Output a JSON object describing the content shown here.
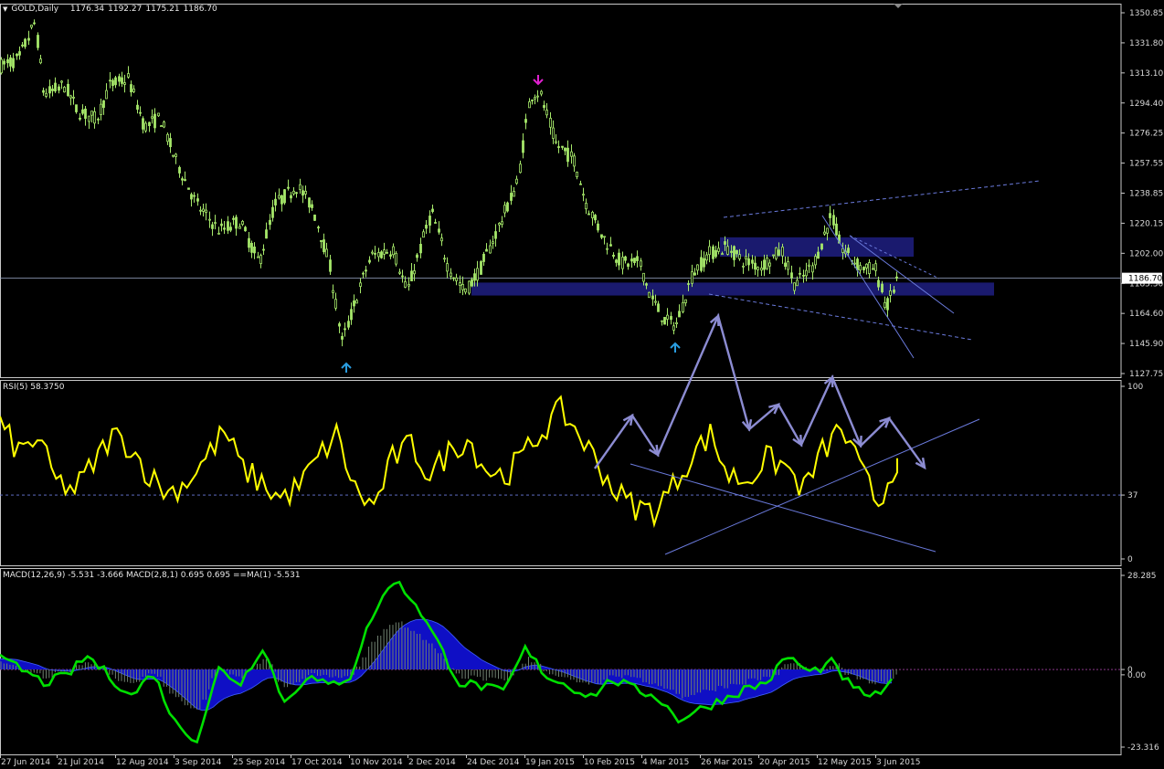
{
  "panels": {
    "price": {
      "symbol_label": "GOLD,Daily",
      "ohlc": [
        "1176.34",
        "1192.27",
        "1175.21",
        "1186.70"
      ],
      "current_price_tag": "1186.70",
      "y_ticks": [
        "1350.85",
        "1331.80",
        "1313.10",
        "1294.40",
        "1276.25",
        "1257.55",
        "1238.85",
        "1220.15",
        "1202.00",
        "1185.30",
        "1164.60",
        "1145.90",
        "1127.75"
      ]
    },
    "rsi": {
      "label": "RSI(5) 58.3750",
      "y_ticks": [
        "100",
        "37",
        "0"
      ]
    },
    "macd": {
      "label": "MACD(12,26,9) -5.531 -3.666  MACD(2,8,1) 0.695 0.695  ==MA(1) -5.531",
      "y_ticks": [
        "28.285",
        "0",
        "0.00",
        "-23.316"
      ]
    }
  },
  "x_axis_labels": [
    "27 Jun 2014",
    "21 Jul 2014",
    "12 Aug 2014",
    "3 Sep 2014",
    "25 Sep 2014",
    "17 Oct 2014",
    "10 Nov 2014",
    "2 Dec 2014",
    "24 Dec 2014",
    "19 Jan 2015",
    "10 Feb 2015",
    "4 Mar 2015",
    "26 Mar 2015",
    "20 Apr 2015",
    "12 May 2015",
    "3 Jun 2015"
  ],
  "colors": {
    "background": "#000000",
    "candle": "#a6e86a",
    "rsi_line": "#ffff00",
    "macd_line": "#00e000",
    "macd_fill": "#1010d0",
    "macd_hist": "#708070",
    "zone": "#1a1a6e",
    "trendline": "#6a7adc",
    "arrow_path": "#8c8cd2",
    "up_arrow": "#2a9de0",
    "down_arrow": "#e020d0",
    "grid_line": "#a0a0a0"
  },
  "chart_data": [
    {
      "type": "candlestick",
      "title": "GOLD,Daily",
      "ylim": [
        1127.75,
        1350.85
      ],
      "x_range": [
        "27 Jun 2014",
        "3 Jun 2015"
      ],
      "approx_close_path": [
        {
          "date": "27 Jun 2014",
          "close": 1318
        },
        {
          "date": "21 Jul 2014",
          "close": 1310
        },
        {
          "date": "12 Aug 2014",
          "close": 1310
        },
        {
          "date": "3 Sep 2014",
          "close": 1268
        },
        {
          "date": "25 Sep 2014",
          "close": 1220
        },
        {
          "date": "17 Oct 2014",
          "close": 1238
        },
        {
          "date": "10 Nov 2014",
          "close": 1148
        },
        {
          "date": "2 Dec 2014",
          "close": 1200
        },
        {
          "date": "24 Dec 2014",
          "close": 1180
        },
        {
          "date": "19 Jan 2015",
          "close": 1300
        },
        {
          "date": "10 Feb 2015",
          "close": 1238
        },
        {
          "date": "4 Mar 2015",
          "close": 1160
        },
        {
          "date": "26 Mar 2015",
          "close": 1200
        },
        {
          "date": "20 Apr 2015",
          "close": 1195
        },
        {
          "date": "12 May 2015",
          "close": 1225
        },
        {
          "date": "3 Jun 2015",
          "close": 1186.7
        }
      ],
      "last": {
        "open": 1176.34,
        "high": 1192.27,
        "low": 1175.21,
        "close": 1186.7
      },
      "current_line": 1186.7
    },
    {
      "type": "line",
      "title": "RSI(5) 58.3750",
      "ylim": [
        0,
        100
      ],
      "level": 37,
      "series": [
        {
          "values": [
            78,
            62,
            70,
            45,
            40,
            55,
            72,
            65,
            48,
            38,
            45,
            58,
            74,
            52,
            44,
            35,
            42,
            58,
            72,
            40,
            30,
            58,
            66,
            48,
            62,
            70,
            52,
            48,
            60,
            74,
            86,
            72,
            55,
            38,
            30,
            28,
            42,
            60,
            72,
            48,
            46,
            58,
            54,
            40,
            62,
            76,
            52,
            32,
            58
          ]
        }
      ]
    },
    {
      "type": "line",
      "title": "MACD(12,26,9) -5.531 -3.666  MACD(2,8,1) 0.695 0.695  ==MA(1) -5.531",
      "ylim": [
        -23.316,
        28.285
      ],
      "series": [
        {
          "values": [
            3,
            0,
            -4,
            -2,
            4,
            -2,
            -8,
            -1,
            -16,
            -21,
            0,
            -4,
            7,
            -10,
            -2,
            -5,
            -2,
            16,
            27,
            20,
            8,
            -4,
            -5,
            -7,
            6,
            -2,
            -5,
            -8,
            -3,
            -6,
            -8,
            -15,
            -12,
            -9,
            -6,
            -4,
            4,
            -1,
            2,
            -6,
            -8,
            -3
          ]
        }
      ]
    }
  ]
}
